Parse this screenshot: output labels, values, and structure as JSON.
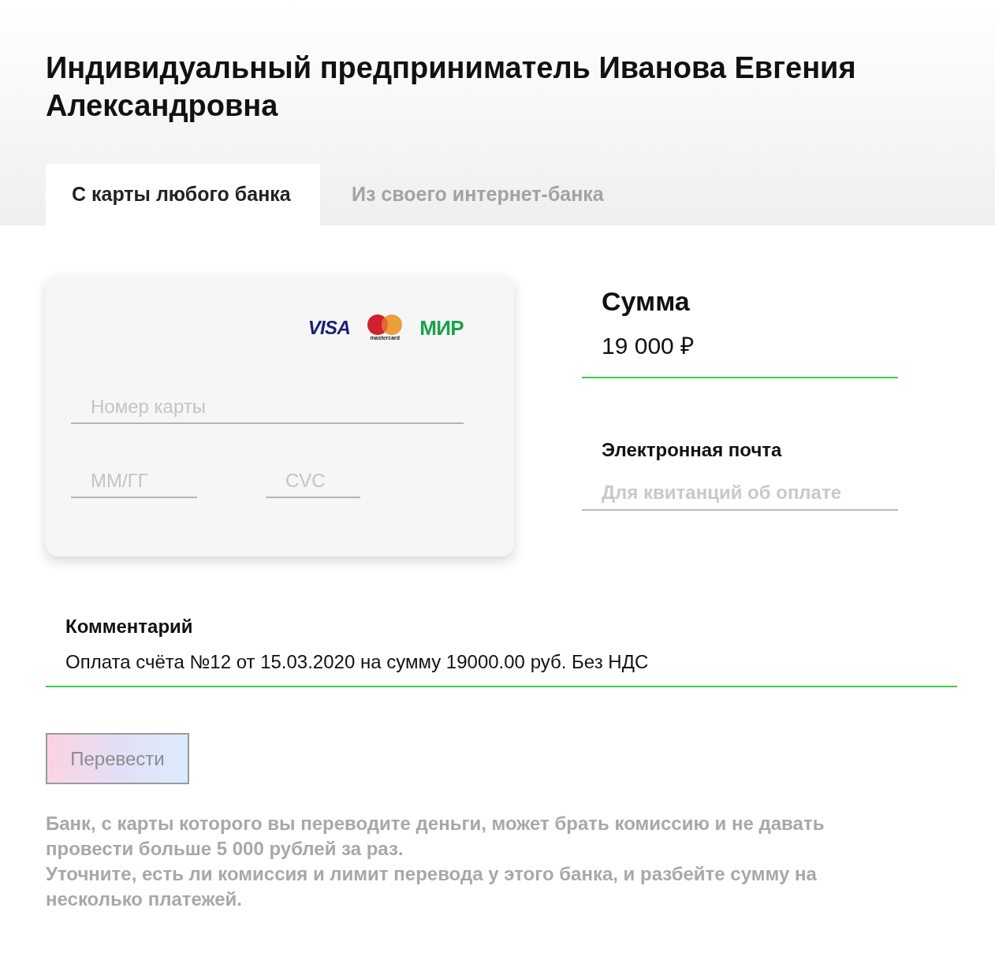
{
  "header": {
    "title": "Индивидуальный предприниматель Иванова Евгения Александровна"
  },
  "tabs": [
    {
      "label": "С карты любого банка",
      "selected": true
    },
    {
      "label": "Из своего интернет-банка",
      "selected": false
    }
  ],
  "card_form": {
    "logos": [
      {
        "kind": "visa",
        "text": "VISA"
      },
      {
        "kind": "mastercard",
        "text": "mastercard"
      },
      {
        "kind": "mir",
        "text": "МИР"
      }
    ],
    "card_number": {
      "placeholder": "Номер карты"
    },
    "expiry": {
      "placeholder": "ММ/ГГ"
    },
    "cvc": {
      "placeholder": "CVC"
    }
  },
  "amount": {
    "label": "Сумма",
    "value": "19 000 ₽",
    "valid": true
  },
  "email": {
    "label": "Электронная почта",
    "placeholder": "Для квитанций об оплате",
    "valid": false
  },
  "comment": {
    "label": "Комментарий",
    "value": "Оплата счёта №12 от 15.03.2020 на сумму 19000.00 руб. Без НДС",
    "valid": true
  },
  "submit_button": {
    "label": "Перевести",
    "disabled": true
  },
  "notes": [
    "Банк, с карты которого вы переводите деньги, может брать комиссию и не давать провести больше 5 000 рублей за раз.",
    "Уточните, есть ли комиссия и лимит перевода у этого банка, и разбейте сумму на несколько платежей."
  ]
}
